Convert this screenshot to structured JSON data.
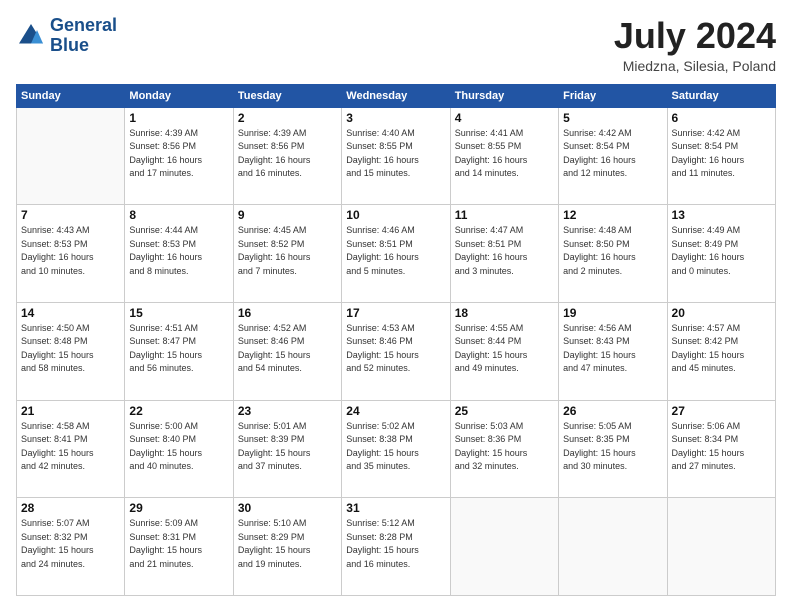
{
  "logo": {
    "line1": "General",
    "line2": "Blue"
  },
  "title": "July 2024",
  "location": "Miedzna, Silesia, Poland",
  "days_header": [
    "Sunday",
    "Monday",
    "Tuesday",
    "Wednesday",
    "Thursday",
    "Friday",
    "Saturday"
  ],
  "weeks": [
    [
      {
        "day": "",
        "info": ""
      },
      {
        "day": "1",
        "info": "Sunrise: 4:39 AM\nSunset: 8:56 PM\nDaylight: 16 hours\nand 17 minutes."
      },
      {
        "day": "2",
        "info": "Sunrise: 4:39 AM\nSunset: 8:56 PM\nDaylight: 16 hours\nand 16 minutes."
      },
      {
        "day": "3",
        "info": "Sunrise: 4:40 AM\nSunset: 8:55 PM\nDaylight: 16 hours\nand 15 minutes."
      },
      {
        "day": "4",
        "info": "Sunrise: 4:41 AM\nSunset: 8:55 PM\nDaylight: 16 hours\nand 14 minutes."
      },
      {
        "day": "5",
        "info": "Sunrise: 4:42 AM\nSunset: 8:54 PM\nDaylight: 16 hours\nand 12 minutes."
      },
      {
        "day": "6",
        "info": "Sunrise: 4:42 AM\nSunset: 8:54 PM\nDaylight: 16 hours\nand 11 minutes."
      }
    ],
    [
      {
        "day": "7",
        "info": "Sunrise: 4:43 AM\nSunset: 8:53 PM\nDaylight: 16 hours\nand 10 minutes."
      },
      {
        "day": "8",
        "info": "Sunrise: 4:44 AM\nSunset: 8:53 PM\nDaylight: 16 hours\nand 8 minutes."
      },
      {
        "day": "9",
        "info": "Sunrise: 4:45 AM\nSunset: 8:52 PM\nDaylight: 16 hours\nand 7 minutes."
      },
      {
        "day": "10",
        "info": "Sunrise: 4:46 AM\nSunset: 8:51 PM\nDaylight: 16 hours\nand 5 minutes."
      },
      {
        "day": "11",
        "info": "Sunrise: 4:47 AM\nSunset: 8:51 PM\nDaylight: 16 hours\nand 3 minutes."
      },
      {
        "day": "12",
        "info": "Sunrise: 4:48 AM\nSunset: 8:50 PM\nDaylight: 16 hours\nand 2 minutes."
      },
      {
        "day": "13",
        "info": "Sunrise: 4:49 AM\nSunset: 8:49 PM\nDaylight: 16 hours\nand 0 minutes."
      }
    ],
    [
      {
        "day": "14",
        "info": "Sunrise: 4:50 AM\nSunset: 8:48 PM\nDaylight: 15 hours\nand 58 minutes."
      },
      {
        "day": "15",
        "info": "Sunrise: 4:51 AM\nSunset: 8:47 PM\nDaylight: 15 hours\nand 56 minutes."
      },
      {
        "day": "16",
        "info": "Sunrise: 4:52 AM\nSunset: 8:46 PM\nDaylight: 15 hours\nand 54 minutes."
      },
      {
        "day": "17",
        "info": "Sunrise: 4:53 AM\nSunset: 8:46 PM\nDaylight: 15 hours\nand 52 minutes."
      },
      {
        "day": "18",
        "info": "Sunrise: 4:55 AM\nSunset: 8:44 PM\nDaylight: 15 hours\nand 49 minutes."
      },
      {
        "day": "19",
        "info": "Sunrise: 4:56 AM\nSunset: 8:43 PM\nDaylight: 15 hours\nand 47 minutes."
      },
      {
        "day": "20",
        "info": "Sunrise: 4:57 AM\nSunset: 8:42 PM\nDaylight: 15 hours\nand 45 minutes."
      }
    ],
    [
      {
        "day": "21",
        "info": "Sunrise: 4:58 AM\nSunset: 8:41 PM\nDaylight: 15 hours\nand 42 minutes."
      },
      {
        "day": "22",
        "info": "Sunrise: 5:00 AM\nSunset: 8:40 PM\nDaylight: 15 hours\nand 40 minutes."
      },
      {
        "day": "23",
        "info": "Sunrise: 5:01 AM\nSunset: 8:39 PM\nDaylight: 15 hours\nand 37 minutes."
      },
      {
        "day": "24",
        "info": "Sunrise: 5:02 AM\nSunset: 8:38 PM\nDaylight: 15 hours\nand 35 minutes."
      },
      {
        "day": "25",
        "info": "Sunrise: 5:03 AM\nSunset: 8:36 PM\nDaylight: 15 hours\nand 32 minutes."
      },
      {
        "day": "26",
        "info": "Sunrise: 5:05 AM\nSunset: 8:35 PM\nDaylight: 15 hours\nand 30 minutes."
      },
      {
        "day": "27",
        "info": "Sunrise: 5:06 AM\nSunset: 8:34 PM\nDaylight: 15 hours\nand 27 minutes."
      }
    ],
    [
      {
        "day": "28",
        "info": "Sunrise: 5:07 AM\nSunset: 8:32 PM\nDaylight: 15 hours\nand 24 minutes."
      },
      {
        "day": "29",
        "info": "Sunrise: 5:09 AM\nSunset: 8:31 PM\nDaylight: 15 hours\nand 21 minutes."
      },
      {
        "day": "30",
        "info": "Sunrise: 5:10 AM\nSunset: 8:29 PM\nDaylight: 15 hours\nand 19 minutes."
      },
      {
        "day": "31",
        "info": "Sunrise: 5:12 AM\nSunset: 8:28 PM\nDaylight: 15 hours\nand 16 minutes."
      },
      {
        "day": "",
        "info": ""
      },
      {
        "day": "",
        "info": ""
      },
      {
        "day": "",
        "info": ""
      }
    ]
  ]
}
